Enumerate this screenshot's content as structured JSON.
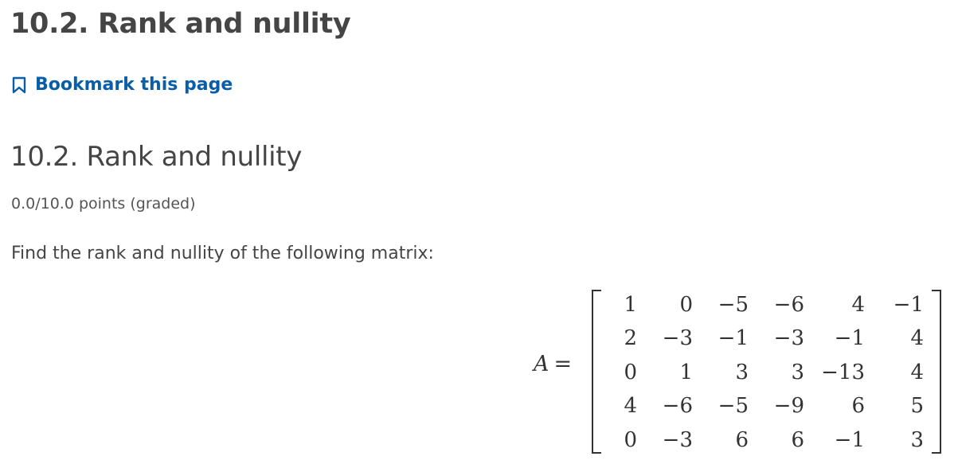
{
  "header": {
    "title": "10.2. Rank and nullity",
    "bookmark_label": "Bookmark this page"
  },
  "problem": {
    "title": "10.2. Rank and nullity",
    "points": "0.0/10.0 points (graded)",
    "prompt": "Find the rank and nullity of the following matrix:",
    "matrix_variable": "A",
    "equals": "=",
    "matrix": [
      [
        "1",
        "0",
        "−5",
        "−6",
        "4",
        "−1"
      ],
      [
        "2",
        "−3",
        "−1",
        "−3",
        "−1",
        "4"
      ],
      [
        "0",
        "1",
        "3",
        "3",
        "−13",
        "4"
      ],
      [
        "4",
        "−6",
        "−5",
        "−9",
        "6",
        "5"
      ],
      [
        "0",
        "−3",
        "6",
        "6",
        "−1",
        "3"
      ]
    ]
  },
  "icons": {
    "bookmark": "bookmark-icon"
  },
  "colors": {
    "link": "#0a5ea8",
    "heading": "#454545",
    "text": "#454545"
  }
}
